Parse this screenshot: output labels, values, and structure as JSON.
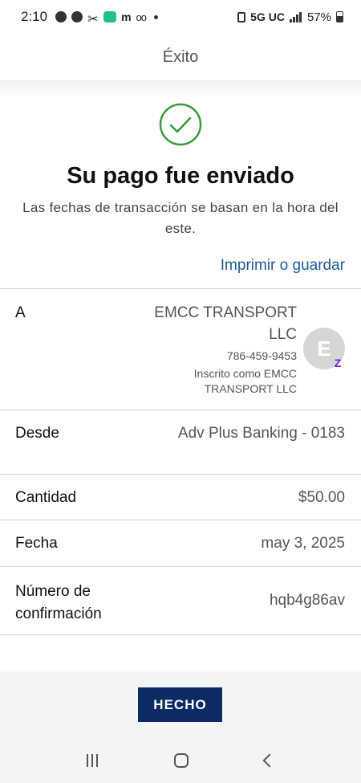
{
  "status_bar": {
    "time": "2:10",
    "network": "5G UC",
    "battery": "57%"
  },
  "header": {
    "title": "Éxito"
  },
  "success": {
    "title": "Su pago fue enviado",
    "subtitle": "Las fechas de transacción se basan en la hora del este.",
    "print_link": "Imprimir o guardar"
  },
  "details": {
    "to_label": "A",
    "recipient_name": "EMCC TRANSPORT LLC",
    "recipient_phone": "786-459-9453",
    "recipient_enrolled": "Inscrito como EMCC TRANSPORT LLC",
    "avatar_initial": "E",
    "from_label": "Desde",
    "from_value": "Adv Plus Banking - 0183",
    "amount_label": "Cantidad",
    "amount_value": "$50.00",
    "date_label": "Fecha",
    "date_value": "may 3, 2025",
    "confirmation_label": "Número de confirmación",
    "confirmation_value": "hqb4g86av"
  },
  "footer": {
    "done_button": "HECHO"
  },
  "colors": {
    "link": "#1e5a96",
    "success_green": "#3a9a3a",
    "button_navy": "#0c2a63",
    "zelle_purple": "#6d1ed4"
  }
}
